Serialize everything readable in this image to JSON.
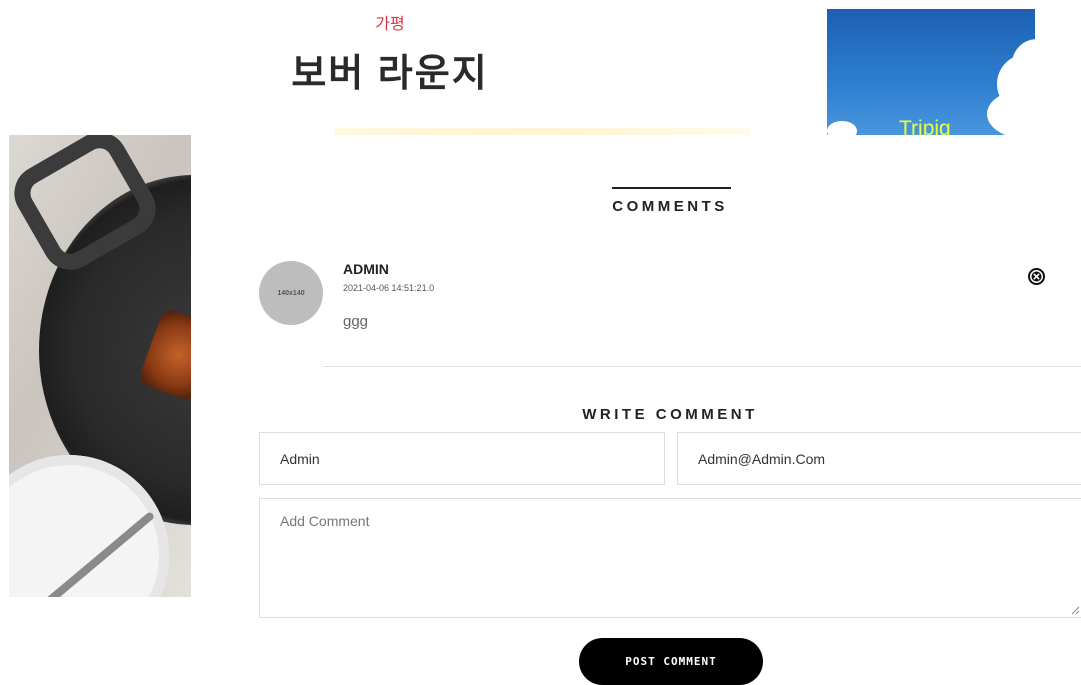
{
  "header": {
    "region": "가평",
    "title": "보버 라운지",
    "thumbnail_label": "Tripig"
  },
  "comments": {
    "heading": "COMMENTS",
    "items": [
      {
        "avatar_text": "140x140",
        "author": "ADMIN",
        "date": "2021-04-06 14:51:21.0",
        "text": "ggg",
        "delete_icon": "close-circle-icon"
      }
    ]
  },
  "write": {
    "heading": "WRITE COMMENT",
    "name_value": "Admin",
    "email_value": "Admin@Admin.Com",
    "comment_placeholder": "Add Comment",
    "submit_label": "POST COMMENT"
  },
  "colors": {
    "accent": "#e0353e",
    "button": "#000000",
    "thumbnail_label": "#e6ff3a"
  }
}
